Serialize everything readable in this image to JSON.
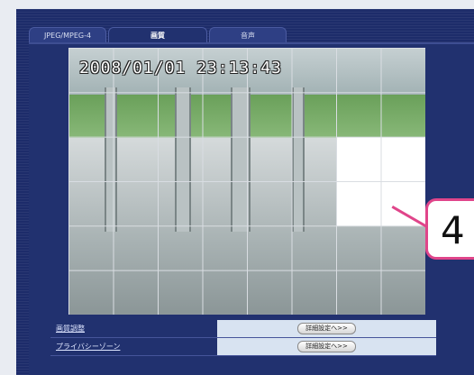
{
  "tabs": [
    {
      "label": "JPEG/MPEG-4",
      "active": false
    },
    {
      "label": "画質",
      "active": true
    },
    {
      "label": "音声",
      "active": false
    }
  ],
  "camera": {
    "timestamp": "2008/01/01 23:13:43",
    "grid_columns": 8,
    "grid_rows": 6
  },
  "callout": {
    "label": "4"
  },
  "settings": [
    {
      "label": "画質調整",
      "button": "詳細設定へ>>"
    },
    {
      "label": "プライバシーゾーン",
      "button": "詳細設定へ>>"
    }
  ],
  "colors": {
    "accent": "#e0458a",
    "background": "#1d2c6a"
  }
}
